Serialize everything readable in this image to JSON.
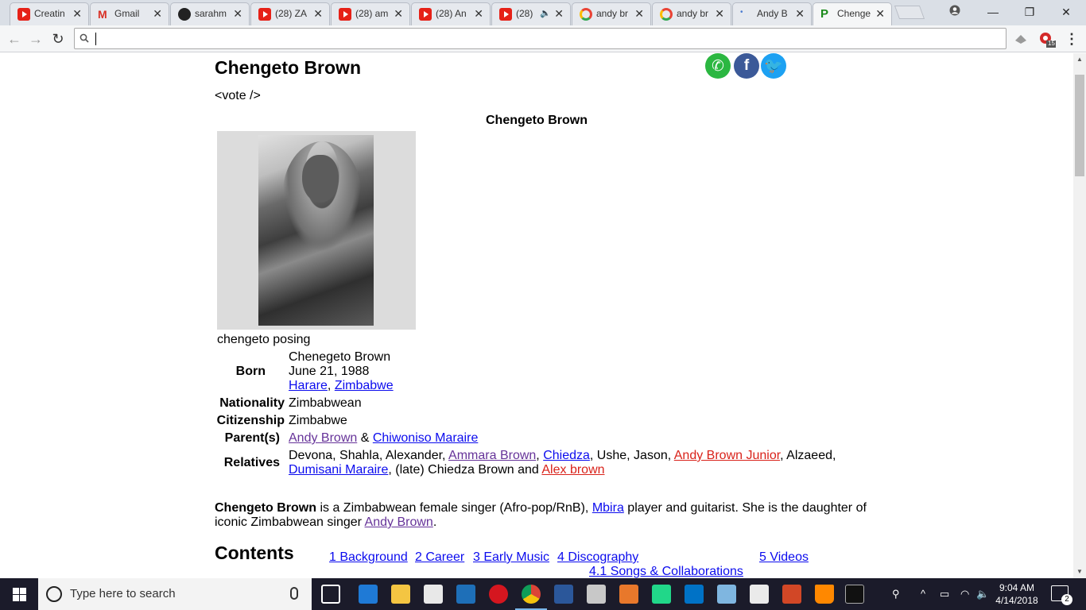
{
  "browser": {
    "tabs": [
      {
        "title": "Creatin",
        "icon": "youtube-icon"
      },
      {
        "title": "Gmail",
        "icon": "gmail-icon"
      },
      {
        "title": "sarahm",
        "icon": "github-icon"
      },
      {
        "title": "(28) ZA",
        "icon": "youtube-icon"
      },
      {
        "title": "(28) am",
        "icon": "youtube-icon"
      },
      {
        "title": "(28) An",
        "icon": "youtube-icon"
      },
      {
        "title": "(28)",
        "icon": "youtube-icon",
        "audio": "🔈"
      },
      {
        "title": "andy br",
        "icon": "google-icon"
      },
      {
        "title": "andy br",
        "icon": "google-icon"
      },
      {
        "title": "Andy B",
        "icon": "loading-icon"
      },
      {
        "title": "Chenge",
        "icon": "p-icon"
      }
    ],
    "omnibox_value": "",
    "extension_badge": "15"
  },
  "article": {
    "title": "Chengeto Brown",
    "vote_tag": "<vote />",
    "infobox": {
      "title": "Chengeto Brown",
      "caption": "chengeto posing",
      "born_label": "Born",
      "born_name": "Chenegeto Brown",
      "born_date": "June 21, 1988",
      "born_city": "Harare",
      "born_sep": ",",
      "born_country": "Zimbabwe",
      "nationality_label": "Nationality",
      "nationality": "Zimbabwean",
      "citizenship_label": "Citizenship",
      "citizenship": "Zimbabwe",
      "parents_label": "Parent(s)",
      "parent1": "Andy Brown",
      "parents_amp": "&",
      "parent2": "Chiwoniso Maraire",
      "relatives_label": "Relatives",
      "rel_text1": "Devona, Shahla, Alexander,",
      "rel_link1": "Ammara Brown",
      "rel_comma1": ",",
      "rel_link2": "Chiedza",
      "rel_text2": ", Ushe, Jason,",
      "rel_link3": "Andy Brown Junior",
      "rel_text3": ", Alzaeed,",
      "rel_link4": "Dumisani Maraire",
      "rel_text4": ", (late) Chiedza Brown and",
      "rel_link5": "Alex brown"
    },
    "intro_bold": "Chengeto Brown",
    "intro_text1": " is a Zimbabwean female singer (Afro-pop/RnB),",
    "intro_link1": "Mbira",
    "intro_text2": " player and guitarist. She is the daughter of iconic Zimbabwean singer",
    "intro_link2": "Andy Brown",
    "intro_end": ".",
    "contents_heading": "Contents",
    "toc": {
      "item1": "1 Background",
      "item2": "2 Career",
      "item3": "3 Early Music",
      "item4": "4 Discography",
      "item4_1": "4.1 Songs & Collaborations",
      "item5": "5 Videos"
    }
  },
  "taskbar": {
    "search_placeholder": "Type here to search",
    "time": "9:04 AM",
    "date": "4/14/2018",
    "notification_count": "2"
  },
  "colors": {
    "link": "#0b0bee",
    "visited_link": "#663399",
    "missing_link": "#d9221a",
    "whatsapp": "#2bb741",
    "facebook": "#3b5998",
    "twitter": "#1da1f2"
  }
}
